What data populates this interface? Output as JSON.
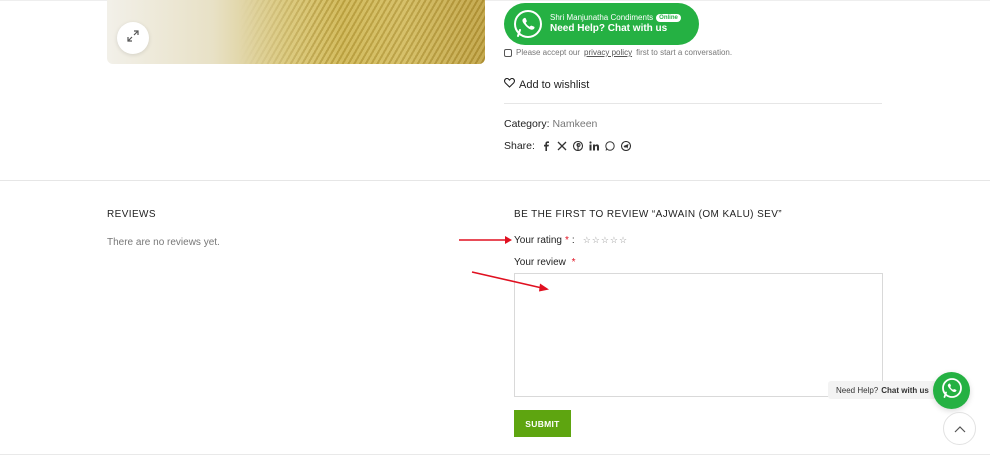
{
  "product": {
    "zoom_icon": "expand-icon"
  },
  "whatsapp_widget": {
    "store_name": "Shri Manjunatha Condiments",
    "status_badge": "Online",
    "help_text": "Need Help? Chat with us",
    "icon": "whatsapp-icon",
    "color": "#25b143"
  },
  "consent": {
    "prefix": "Please accept our",
    "link": "privacy policy",
    "suffix": "first to start a conversation."
  },
  "wishlist": {
    "label": "Add to wishlist",
    "icon": "heart-icon"
  },
  "category": {
    "label": "Category:",
    "value": "Namkeen"
  },
  "share": {
    "label": "Share:",
    "icons": [
      "facebook-icon",
      "x-icon",
      "pinterest-icon",
      "linkedin-icon",
      "whatsapp-icon",
      "telegram-icon"
    ]
  },
  "reviews": {
    "title": "REVIEWS",
    "empty_text": "There are no reviews yet."
  },
  "review_form": {
    "heading": "BE THE FIRST TO REVIEW “AJWAIN (OM KALU) SEV”",
    "rating_label": "Your rating",
    "rating_required": "*",
    "rating_colon": ":",
    "stars": [
      "☆",
      "☆",
      "☆",
      "☆",
      "☆"
    ],
    "review_label": "Your review",
    "review_required": "*",
    "review_value": "",
    "submit_label": "SUBMIT",
    "submit_color": "#5ea510"
  },
  "chat_float": {
    "prefix": "Need Help?",
    "bold": "Chat with us",
    "icon": "whatsapp-icon"
  },
  "scroll_top": {
    "icon": "chevron-up-icon"
  },
  "annotation_color": "#e01020"
}
